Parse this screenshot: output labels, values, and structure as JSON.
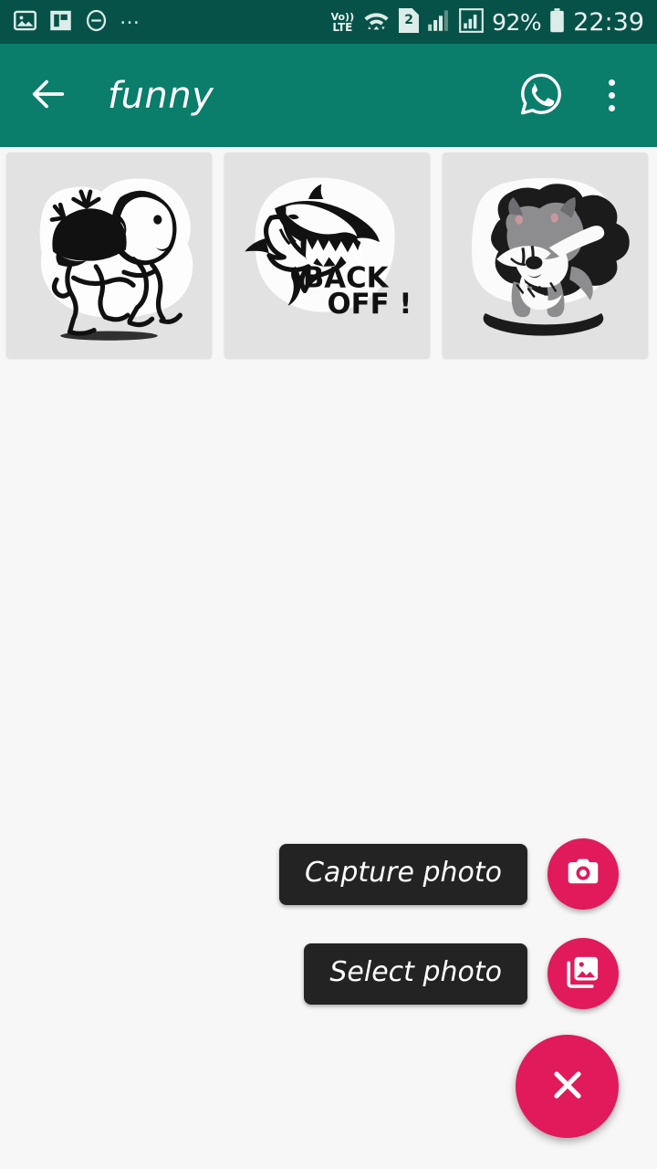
{
  "status_bar": {
    "background": "#075248",
    "left_icons": [
      {
        "name": "image-notification-icon",
        "glyph": "image"
      },
      {
        "name": "flipboard-notification-icon",
        "glyph": "flipboard"
      },
      {
        "name": "do-not-disturb-icon",
        "glyph": "minus-circle"
      },
      {
        "name": "more-notifications-icon",
        "glyph": "ellipsis"
      }
    ],
    "volte_top": "Vo))",
    "volte_bottom": "LTE",
    "wifi_icon": "wifi-updown-icon",
    "sim_slot": "2",
    "signal_1_icon": "signal-bars-icon",
    "signal_2_icon": "signal-bars-boxed-icon",
    "battery_percent": "92%",
    "battery_icon": "battery-icon",
    "clock": "22:39"
  },
  "app_bar": {
    "background": "#0a7d6b",
    "back_icon": "arrow-left-icon",
    "title": "funny",
    "whatsapp_icon": "whatsapp-icon",
    "overflow_icon": "more-vertical-icon"
  },
  "stickers": [
    {
      "name": "sticker-kids-cartoon",
      "alt": "two cartoon kids black and white sticker"
    },
    {
      "name": "sticker-shark-back-off",
      "alt": "shark sticker",
      "text_line1": "BACK",
      "text_line2": "OFF !"
    },
    {
      "name": "sticker-dabbing-dog",
      "alt": "dabbing schnauzer dog sticker"
    }
  ],
  "fab_menu": {
    "accent_color": "#e01a5b",
    "capture": {
      "label": "Capture photo",
      "icon": "camera-icon"
    },
    "select": {
      "label": "Select photo",
      "icon": "photo-library-icon"
    },
    "close": {
      "icon": "close-icon"
    }
  }
}
